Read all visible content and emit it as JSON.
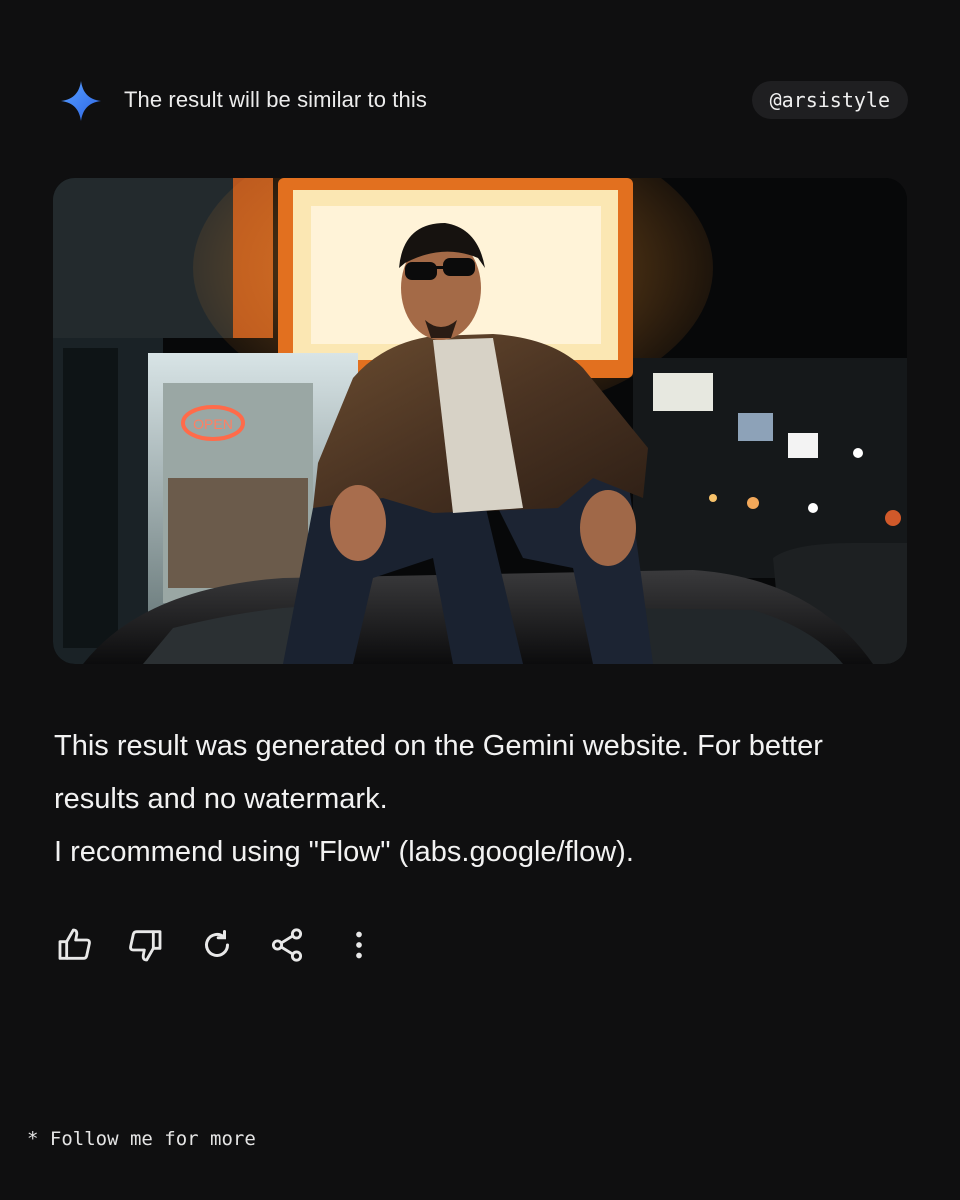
{
  "header": {
    "icon": "gemini-sparkle-icon",
    "title": "The result will be similar to this",
    "handle": "@arsistyle"
  },
  "image": {
    "sign_text": "OPEN"
  },
  "message": {
    "line1": "This result was generated on the Gemini website. For better results and no watermark.",
    "line2": "I recommend using \"Flow\" (labs.google/flow)."
  },
  "actions": [
    {
      "icon": "thumbs-up-icon"
    },
    {
      "icon": "thumbs-down-icon"
    },
    {
      "icon": "regenerate-icon"
    },
    {
      "icon": "share-icon"
    },
    {
      "icon": "more-vert-icon"
    }
  ],
  "footer": {
    "note": "* Follow me for more"
  },
  "colors": {
    "background": "#0f0f10",
    "accent_blue": "#4c8df6",
    "pill": "#1f1f21"
  }
}
